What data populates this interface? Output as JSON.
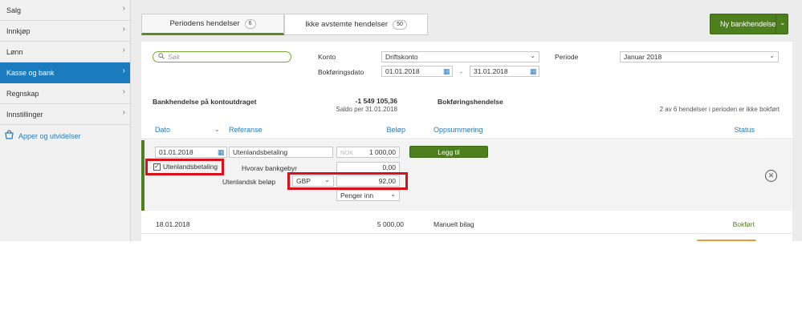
{
  "sidebar": {
    "items": [
      {
        "label": "Salg"
      },
      {
        "label": "Innkjøp"
      },
      {
        "label": "Lønn"
      },
      {
        "label": "Kasse og bank"
      },
      {
        "label": "Regnskap"
      },
      {
        "label": "Innstillinger"
      }
    ],
    "apps_label": "Apper og utvidelser"
  },
  "tabs": [
    {
      "label": "Periodens hendelser",
      "count": "6"
    },
    {
      "label": "Ikke avstemte hendelser",
      "count": "50"
    }
  ],
  "new_button_label": "Ny bankhendelse",
  "filters": {
    "search_placeholder": "Søk",
    "konto_label": "Konto",
    "konto_value": "Driftskonto",
    "periode_label": "Periode",
    "periode_value": "Januar 2018",
    "bokforingsdato_label": "Bokføringsdato",
    "date_from": "01.01.2018",
    "date_separator": "-",
    "date_to": "31.01.2018"
  },
  "summary": {
    "left_title": "Bankhendelse på kontoutdraget",
    "balance": "-1 549 105,36",
    "balance_caption": "Saldo per 31.01.2018",
    "right_title": "Bokføringshendelse",
    "right_note": "2 av 6 hendelser i perioden er ikke bokført"
  },
  "columns": {
    "dato": "Dato",
    "referanse": "Referanse",
    "belop": "Beløp",
    "oppsummering": "Oppsummering",
    "status": "Status"
  },
  "edit_row": {
    "date": "01.01.2018",
    "reference": "Utenlandsbetaling",
    "currency_prefix": "NOK",
    "amount": "1 000,00",
    "add_button": "Legg til",
    "checkbox_label": "Utenlandsbetaling",
    "fee_label": "Hvorav bankgebyr",
    "fee_value": "0,00",
    "foreign_label": "Utenlandsk beløp",
    "foreign_currency": "GBP",
    "foreign_amount": "92,00",
    "direction": "Penger inn"
  },
  "rows": [
    {
      "date": "18.01.2018",
      "amount": "5 000,00",
      "summary": "Manuelt bilag",
      "status": "Bokført"
    }
  ],
  "colors": {
    "accent_blue": "#1a7bbf",
    "green": "#4e7f1d",
    "highlight_red": "#d8101a"
  }
}
